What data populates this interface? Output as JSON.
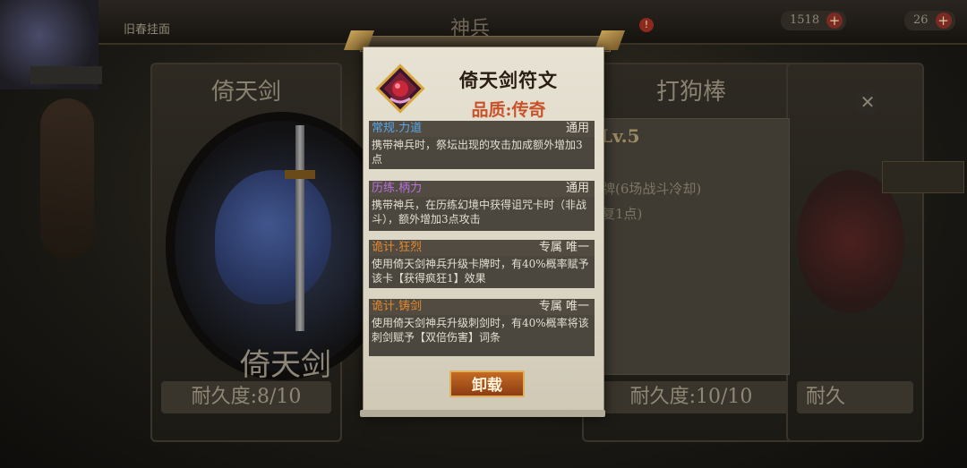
{
  "top": {
    "left_label": "旧春挂面",
    "title": "神兵",
    "notify": "!",
    "resources": [
      {
        "value": "1518",
        "plus": "+"
      },
      {
        "value": "26",
        "plus": "+"
      }
    ]
  },
  "background": {
    "side_tag": "",
    "cards": [
      {
        "title": "倚天剑",
        "durability": "耐久度:8/10"
      },
      {
        "title": "打狗棒",
        "durability": "耐久度:10/10"
      },
      {
        "title": "",
        "durability": "耐久"
      }
    ],
    "weapon_big_name": "倚天剑",
    "right_panel": {
      "level": "Lv.5",
      "line1": "牌(6场战斗冷却)",
      "line2": "复1点)"
    },
    "close": "✕"
  },
  "popup": {
    "title": "倚天剑符文",
    "quality_label": "品质:",
    "quality_value": "传奇",
    "skills": [
      {
        "name": "常规.力道",
        "tag": "通用",
        "desc": "携带神兵时，祭坛出现的攻击加成额外增加3点",
        "color": "#5aa6e8"
      },
      {
        "name": "历练.柄力",
        "tag": "通用",
        "desc": "携带神兵，在历练幻境中获得诅咒卡时（非战斗），额外增加3点攻击",
        "color": "#b772e0"
      },
      {
        "name": "诡计.狂烈",
        "tag": "专属 唯一",
        "desc": "使用倚天剑神兵升级卡牌时，有40%概率赋予该卡【获得疯狂1】效果",
        "color": "#e5892f"
      },
      {
        "name": "诡计.铸剑",
        "tag": "专属 唯一",
        "desc": "使用倚天剑神兵升级刺剑时，有40%概率将该刺剑赋予【双倍伤害】词条",
        "color": "#e5892f"
      }
    ],
    "unload_label": "卸载"
  }
}
